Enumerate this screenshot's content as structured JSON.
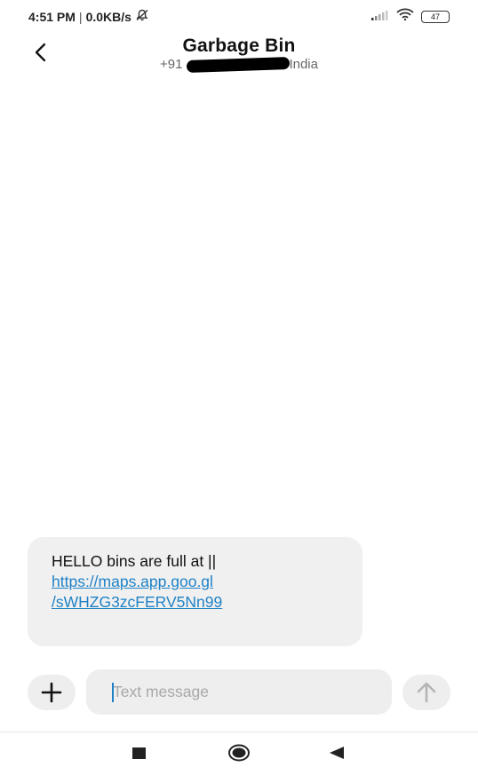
{
  "status_bar": {
    "time": "4:51 PM",
    "separator": "|",
    "speed": "0.0KB/s",
    "battery": "47"
  },
  "header": {
    "title": "Garbage Bin",
    "phone_prefix": "+91",
    "phone_country": "India"
  },
  "message": {
    "text": "HELLO bins are full at ||",
    "link_line1": "https://maps.app.goo.gl",
    "link_line2": "/sWHZG3zcFERV5Nn99"
  },
  "composer": {
    "placeholder": "Text message"
  },
  "colors": {
    "link": "#1f82c6",
    "bubble": "#f0f0f0",
    "input": "#eeeeee"
  },
  "icons": [
    "back-arrow-icon",
    "mute-bell-icon",
    "signal-icon",
    "wifi-icon",
    "battery-icon",
    "plus-icon",
    "send-arrow-icon",
    "recent-apps-icon",
    "home-icon",
    "back-triangle-icon"
  ]
}
